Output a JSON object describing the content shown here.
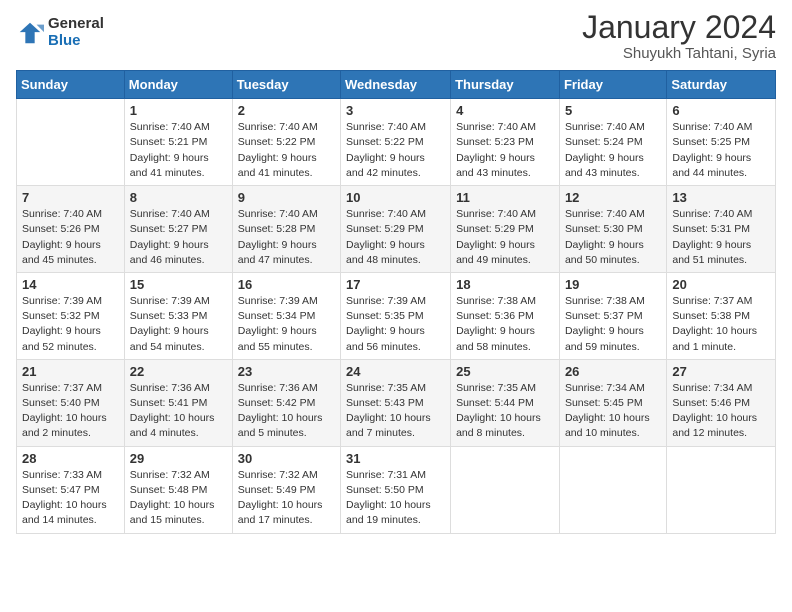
{
  "header": {
    "logo_general": "General",
    "logo_blue": "Blue",
    "month_title": "January 2024",
    "subtitle": "Shuyukh Tahtani, Syria"
  },
  "days_of_week": [
    "Sunday",
    "Monday",
    "Tuesday",
    "Wednesday",
    "Thursday",
    "Friday",
    "Saturday"
  ],
  "weeks": [
    [
      {
        "day": "",
        "info": ""
      },
      {
        "day": "1",
        "info": "Sunrise: 7:40 AM\nSunset: 5:21 PM\nDaylight: 9 hours\nand 41 minutes."
      },
      {
        "day": "2",
        "info": "Sunrise: 7:40 AM\nSunset: 5:22 PM\nDaylight: 9 hours\nand 41 minutes."
      },
      {
        "day": "3",
        "info": "Sunrise: 7:40 AM\nSunset: 5:22 PM\nDaylight: 9 hours\nand 42 minutes."
      },
      {
        "day": "4",
        "info": "Sunrise: 7:40 AM\nSunset: 5:23 PM\nDaylight: 9 hours\nand 43 minutes."
      },
      {
        "day": "5",
        "info": "Sunrise: 7:40 AM\nSunset: 5:24 PM\nDaylight: 9 hours\nand 43 minutes."
      },
      {
        "day": "6",
        "info": "Sunrise: 7:40 AM\nSunset: 5:25 PM\nDaylight: 9 hours\nand 44 minutes."
      }
    ],
    [
      {
        "day": "7",
        "info": "Sunrise: 7:40 AM\nSunset: 5:26 PM\nDaylight: 9 hours\nand 45 minutes."
      },
      {
        "day": "8",
        "info": "Sunrise: 7:40 AM\nSunset: 5:27 PM\nDaylight: 9 hours\nand 46 minutes."
      },
      {
        "day": "9",
        "info": "Sunrise: 7:40 AM\nSunset: 5:28 PM\nDaylight: 9 hours\nand 47 minutes."
      },
      {
        "day": "10",
        "info": "Sunrise: 7:40 AM\nSunset: 5:29 PM\nDaylight: 9 hours\nand 48 minutes."
      },
      {
        "day": "11",
        "info": "Sunrise: 7:40 AM\nSunset: 5:29 PM\nDaylight: 9 hours\nand 49 minutes."
      },
      {
        "day": "12",
        "info": "Sunrise: 7:40 AM\nSunset: 5:30 PM\nDaylight: 9 hours\nand 50 minutes."
      },
      {
        "day": "13",
        "info": "Sunrise: 7:40 AM\nSunset: 5:31 PM\nDaylight: 9 hours\nand 51 minutes."
      }
    ],
    [
      {
        "day": "14",
        "info": "Sunrise: 7:39 AM\nSunset: 5:32 PM\nDaylight: 9 hours\nand 52 minutes."
      },
      {
        "day": "15",
        "info": "Sunrise: 7:39 AM\nSunset: 5:33 PM\nDaylight: 9 hours\nand 54 minutes."
      },
      {
        "day": "16",
        "info": "Sunrise: 7:39 AM\nSunset: 5:34 PM\nDaylight: 9 hours\nand 55 minutes."
      },
      {
        "day": "17",
        "info": "Sunrise: 7:39 AM\nSunset: 5:35 PM\nDaylight: 9 hours\nand 56 minutes."
      },
      {
        "day": "18",
        "info": "Sunrise: 7:38 AM\nSunset: 5:36 PM\nDaylight: 9 hours\nand 58 minutes."
      },
      {
        "day": "19",
        "info": "Sunrise: 7:38 AM\nSunset: 5:37 PM\nDaylight: 9 hours\nand 59 minutes."
      },
      {
        "day": "20",
        "info": "Sunrise: 7:37 AM\nSunset: 5:38 PM\nDaylight: 10 hours\nand 1 minute."
      }
    ],
    [
      {
        "day": "21",
        "info": "Sunrise: 7:37 AM\nSunset: 5:40 PM\nDaylight: 10 hours\nand 2 minutes."
      },
      {
        "day": "22",
        "info": "Sunrise: 7:36 AM\nSunset: 5:41 PM\nDaylight: 10 hours\nand 4 minutes."
      },
      {
        "day": "23",
        "info": "Sunrise: 7:36 AM\nSunset: 5:42 PM\nDaylight: 10 hours\nand 5 minutes."
      },
      {
        "day": "24",
        "info": "Sunrise: 7:35 AM\nSunset: 5:43 PM\nDaylight: 10 hours\nand 7 minutes."
      },
      {
        "day": "25",
        "info": "Sunrise: 7:35 AM\nSunset: 5:44 PM\nDaylight: 10 hours\nand 8 minutes."
      },
      {
        "day": "26",
        "info": "Sunrise: 7:34 AM\nSunset: 5:45 PM\nDaylight: 10 hours\nand 10 minutes."
      },
      {
        "day": "27",
        "info": "Sunrise: 7:34 AM\nSunset: 5:46 PM\nDaylight: 10 hours\nand 12 minutes."
      }
    ],
    [
      {
        "day": "28",
        "info": "Sunrise: 7:33 AM\nSunset: 5:47 PM\nDaylight: 10 hours\nand 14 minutes."
      },
      {
        "day": "29",
        "info": "Sunrise: 7:32 AM\nSunset: 5:48 PM\nDaylight: 10 hours\nand 15 minutes."
      },
      {
        "day": "30",
        "info": "Sunrise: 7:32 AM\nSunset: 5:49 PM\nDaylight: 10 hours\nand 17 minutes."
      },
      {
        "day": "31",
        "info": "Sunrise: 7:31 AM\nSunset: 5:50 PM\nDaylight: 10 hours\nand 19 minutes."
      },
      {
        "day": "",
        "info": ""
      },
      {
        "day": "",
        "info": ""
      },
      {
        "day": "",
        "info": ""
      }
    ]
  ]
}
